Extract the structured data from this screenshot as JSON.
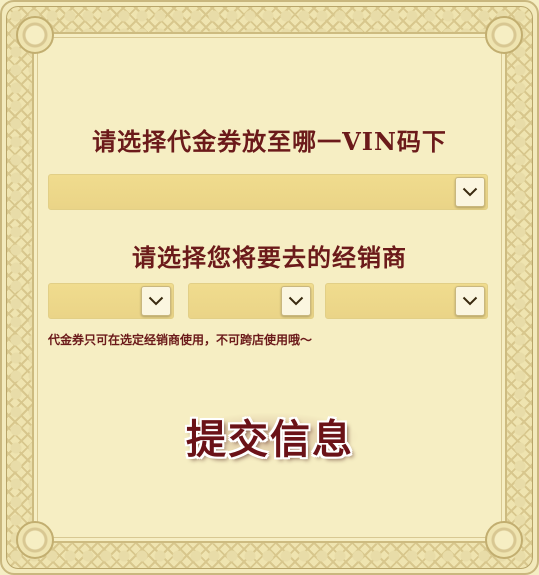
{
  "form": {
    "vin_prompt": "请选择代金券放至哪一VIN码下",
    "vin_select_value": "",
    "dealer_prompt": "请选择您将要去的经销商",
    "dealer_selects": [
      {
        "value": ""
      },
      {
        "value": ""
      },
      {
        "value": ""
      }
    ],
    "note": "代金券只可在选定经销商使用，不可跨店使用哦～",
    "submit_label": "提交信息"
  },
  "icons": {
    "dropdown": "chevron-down-icon"
  },
  "colors": {
    "background": "#f3eabc",
    "text_primary": "#6b1a1a",
    "select_fill": "#ecd68a",
    "border": "#c9b77e"
  }
}
